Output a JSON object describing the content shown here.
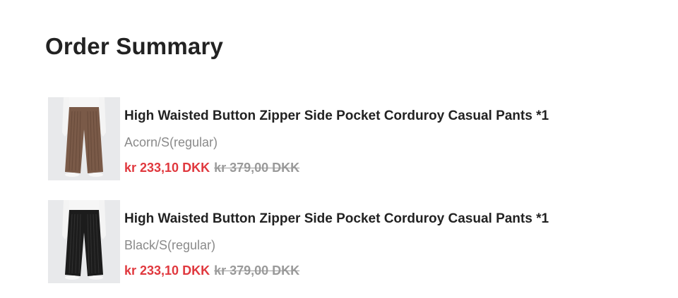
{
  "page": {
    "title": "Order Summary"
  },
  "items": [
    {
      "name": "High Waisted Button Zipper Side Pocket Corduroy Casual Pants *1",
      "variant": "Acorn/S(regular)",
      "sale_price": "kr 233,10 DKK",
      "original_price": "kr 379,00 DKK",
      "pants_color": "#7a5a48"
    },
    {
      "name": "High Waisted Button Zipper Side Pocket Corduroy Casual Pants *1",
      "variant": "Black/S(regular)",
      "sale_price": "kr 233,10 DKK",
      "original_price": "kr 379,00 DKK",
      "pants_color": "#1c1c1c"
    }
  ],
  "colors": {
    "sale": "#e0383e",
    "original": "#9a9a9a",
    "variant": "#8a8a8a",
    "title": "#222222"
  }
}
